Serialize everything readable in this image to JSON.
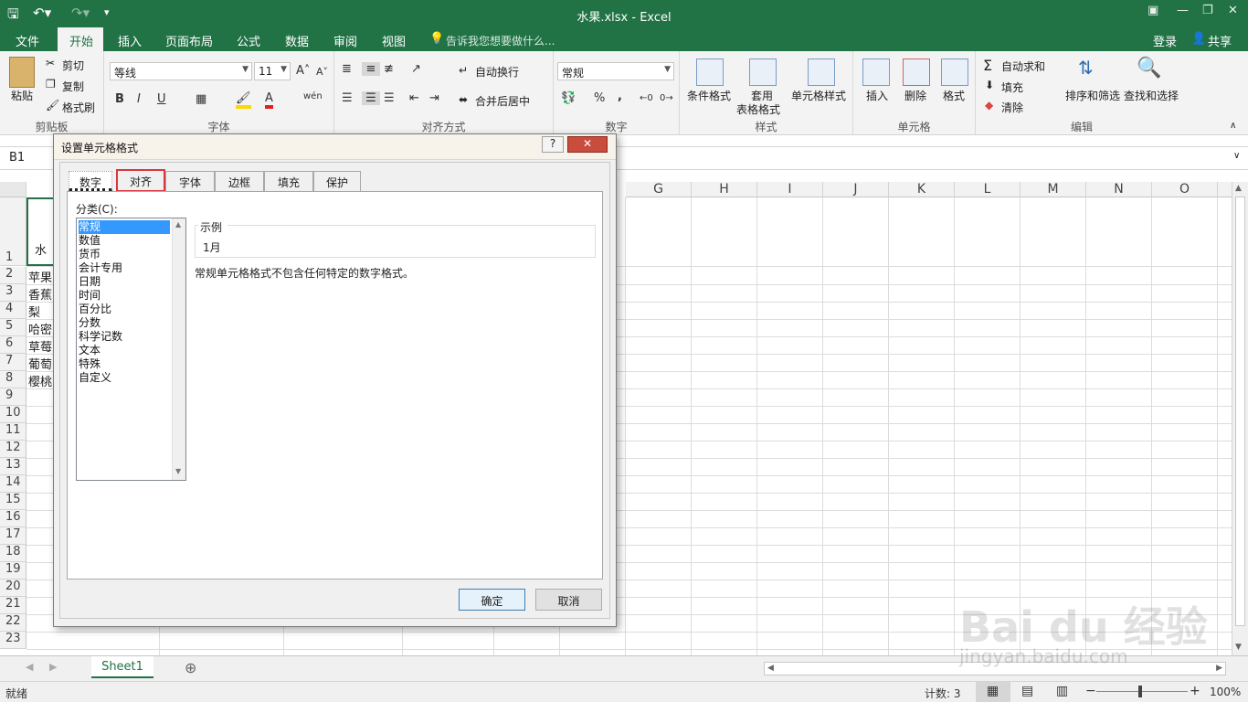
{
  "titlebar": {
    "title": "水果.xlsx - Excel"
  },
  "ribbon_tabs": [
    "文件",
    "开始",
    "插入",
    "页面布局",
    "公式",
    "数据",
    "审阅",
    "视图"
  ],
  "tell_me": "告诉我您想要做什么...",
  "account": {
    "login": "登录",
    "share": "共享"
  },
  "clipboard": {
    "paste": "粘贴",
    "cut": "剪切",
    "copy": "复制",
    "format_painter": "格式刷",
    "label": "剪贴板"
  },
  "font": {
    "name": "等线",
    "size": "11",
    "bold": "B",
    "italic": "I",
    "underline": "U",
    "label": "字体"
  },
  "alignment": {
    "wrap": "自动换行",
    "merge": "合并后居中",
    "label": "对齐方式"
  },
  "number": {
    "format": "常规",
    "percent": "%",
    "comma": ",",
    "label": "数字"
  },
  "styles": {
    "conditional": "条件格式",
    "table1": "套用",
    "table2": "表格格式",
    "cell_styles": "单元格样式",
    "label": "样式"
  },
  "cells": {
    "insert": "插入",
    "delete": "删除",
    "format": "格式",
    "label": "单元格"
  },
  "editing": {
    "autosum": "自动求和",
    "fill": "填充",
    "clear": "清除",
    "sort": "排序和筛选",
    "find": "查找和选择",
    "label": "编辑"
  },
  "formula_bar": {
    "name_box": "B1"
  },
  "columns": [
    "G",
    "H",
    "I",
    "J",
    "K",
    "L",
    "M",
    "N",
    "O"
  ],
  "rows": [
    "1",
    "2",
    "3",
    "4",
    "5",
    "6",
    "7",
    "8",
    "9",
    "10",
    "11",
    "12",
    "13",
    "14",
    "15",
    "16",
    "17",
    "18",
    "19",
    "20",
    "21",
    "22",
    "23"
  ],
  "cells_visible": {
    "a1": "水",
    "r2": "苹果",
    "r3": "香蕉",
    "r4": "梨",
    "r5": "哈密",
    "r6": "草莓",
    "r7": "葡萄",
    "r8": "樱桃"
  },
  "sheet": {
    "tab": "Sheet1"
  },
  "status": {
    "ready": "就绪",
    "count": "计数: 3",
    "zoom": "100%"
  },
  "dialog": {
    "title": "设置单元格格式",
    "help": "?",
    "tabs": [
      "数字",
      "对齐",
      "字体",
      "边框",
      "填充",
      "保护"
    ],
    "category_label": "分类(C):",
    "categories": [
      "常规",
      "数值",
      "货币",
      "会计专用",
      "日期",
      "时间",
      "百分比",
      "分数",
      "科学记数",
      "文本",
      "特殊",
      "自定义"
    ],
    "sample_label": "示例",
    "sample_value": "1月",
    "description": "常规单元格格式不包含任何特定的数字格式。",
    "ok": "确定",
    "cancel": "取消"
  },
  "watermark": {
    "line1": "Bai du 经验",
    "line2": "jingyan.baidu.com"
  }
}
